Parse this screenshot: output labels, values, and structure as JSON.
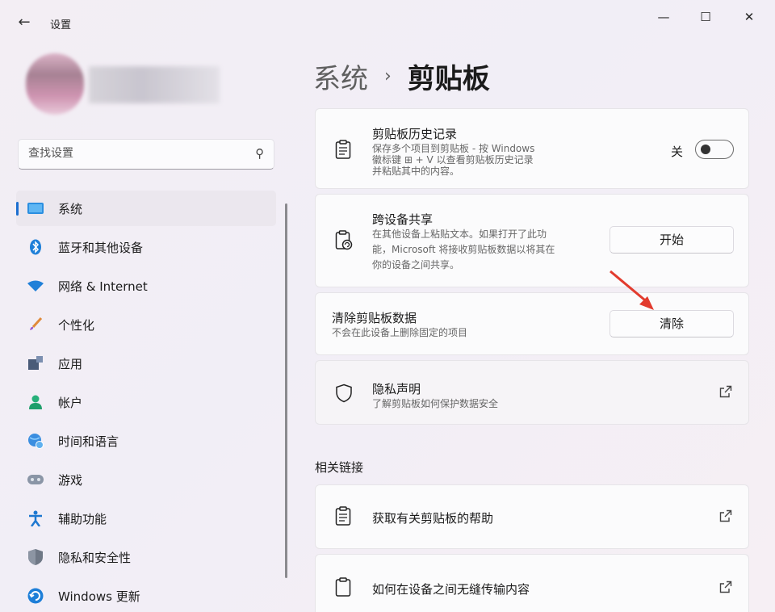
{
  "window": {
    "title": "设置",
    "back_glyph": "←",
    "min_glyph": "—",
    "max_glyph": "☐",
    "close_glyph": "✕"
  },
  "search": {
    "placeholder": "查找设置"
  },
  "sidebar": {
    "items": [
      {
        "label": "系统",
        "icon": "system-monitor-icon",
        "active": true
      },
      {
        "label": "蓝牙和其他设备",
        "icon": "bluetooth-icon"
      },
      {
        "label": "网络 & Internet",
        "icon": "wifi-icon"
      },
      {
        "label": "个性化",
        "icon": "brush-icon"
      },
      {
        "label": "应用",
        "icon": "apps-icon"
      },
      {
        "label": "帐户",
        "icon": "person-icon"
      },
      {
        "label": "时间和语言",
        "icon": "globe-clock-icon"
      },
      {
        "label": "游戏",
        "icon": "gamepad-icon"
      },
      {
        "label": "辅助功能",
        "icon": "accessibility-icon"
      },
      {
        "label": "隐私和安全性",
        "icon": "shield-icon"
      },
      {
        "label": "Windows 更新",
        "icon": "update-icon"
      }
    ]
  },
  "breadcrumb": {
    "parent": "系统",
    "separator": "›",
    "current": "剪贴板"
  },
  "cards": {
    "history": {
      "title": "剪贴板历史记录",
      "desc_lines": [
        "保存多个项目到剪贴板 - 按 Windows",
        "徽标键 ⊞ + V 以查看剪贴板历史记录",
        "并粘贴其中的内容。"
      ],
      "toggle_label": "关",
      "toggle_on": false
    },
    "sync": {
      "title": "跨设备共享",
      "desc_lines": [
        "在其他设备上粘贴文本。如果打开了此功",
        "能，Microsoft 将接收剪贴板数据以将其在",
        "你的设备之间共享。"
      ],
      "button": "开始"
    },
    "clear": {
      "title": "清除剪贴板数据",
      "desc": "不会在此设备上删除固定的项目",
      "button": "清除"
    },
    "privacy": {
      "title": "隐私声明",
      "desc": "了解剪贴板如何保护数据安全"
    }
  },
  "related": {
    "title": "相关链接",
    "links": [
      {
        "label": "获取有关剪贴板的帮助"
      },
      {
        "label": "如何在设备之间无缝传输内容"
      }
    ]
  },
  "colors": {
    "accent": "#1d6fd0",
    "arrow": "#e23b2e"
  }
}
